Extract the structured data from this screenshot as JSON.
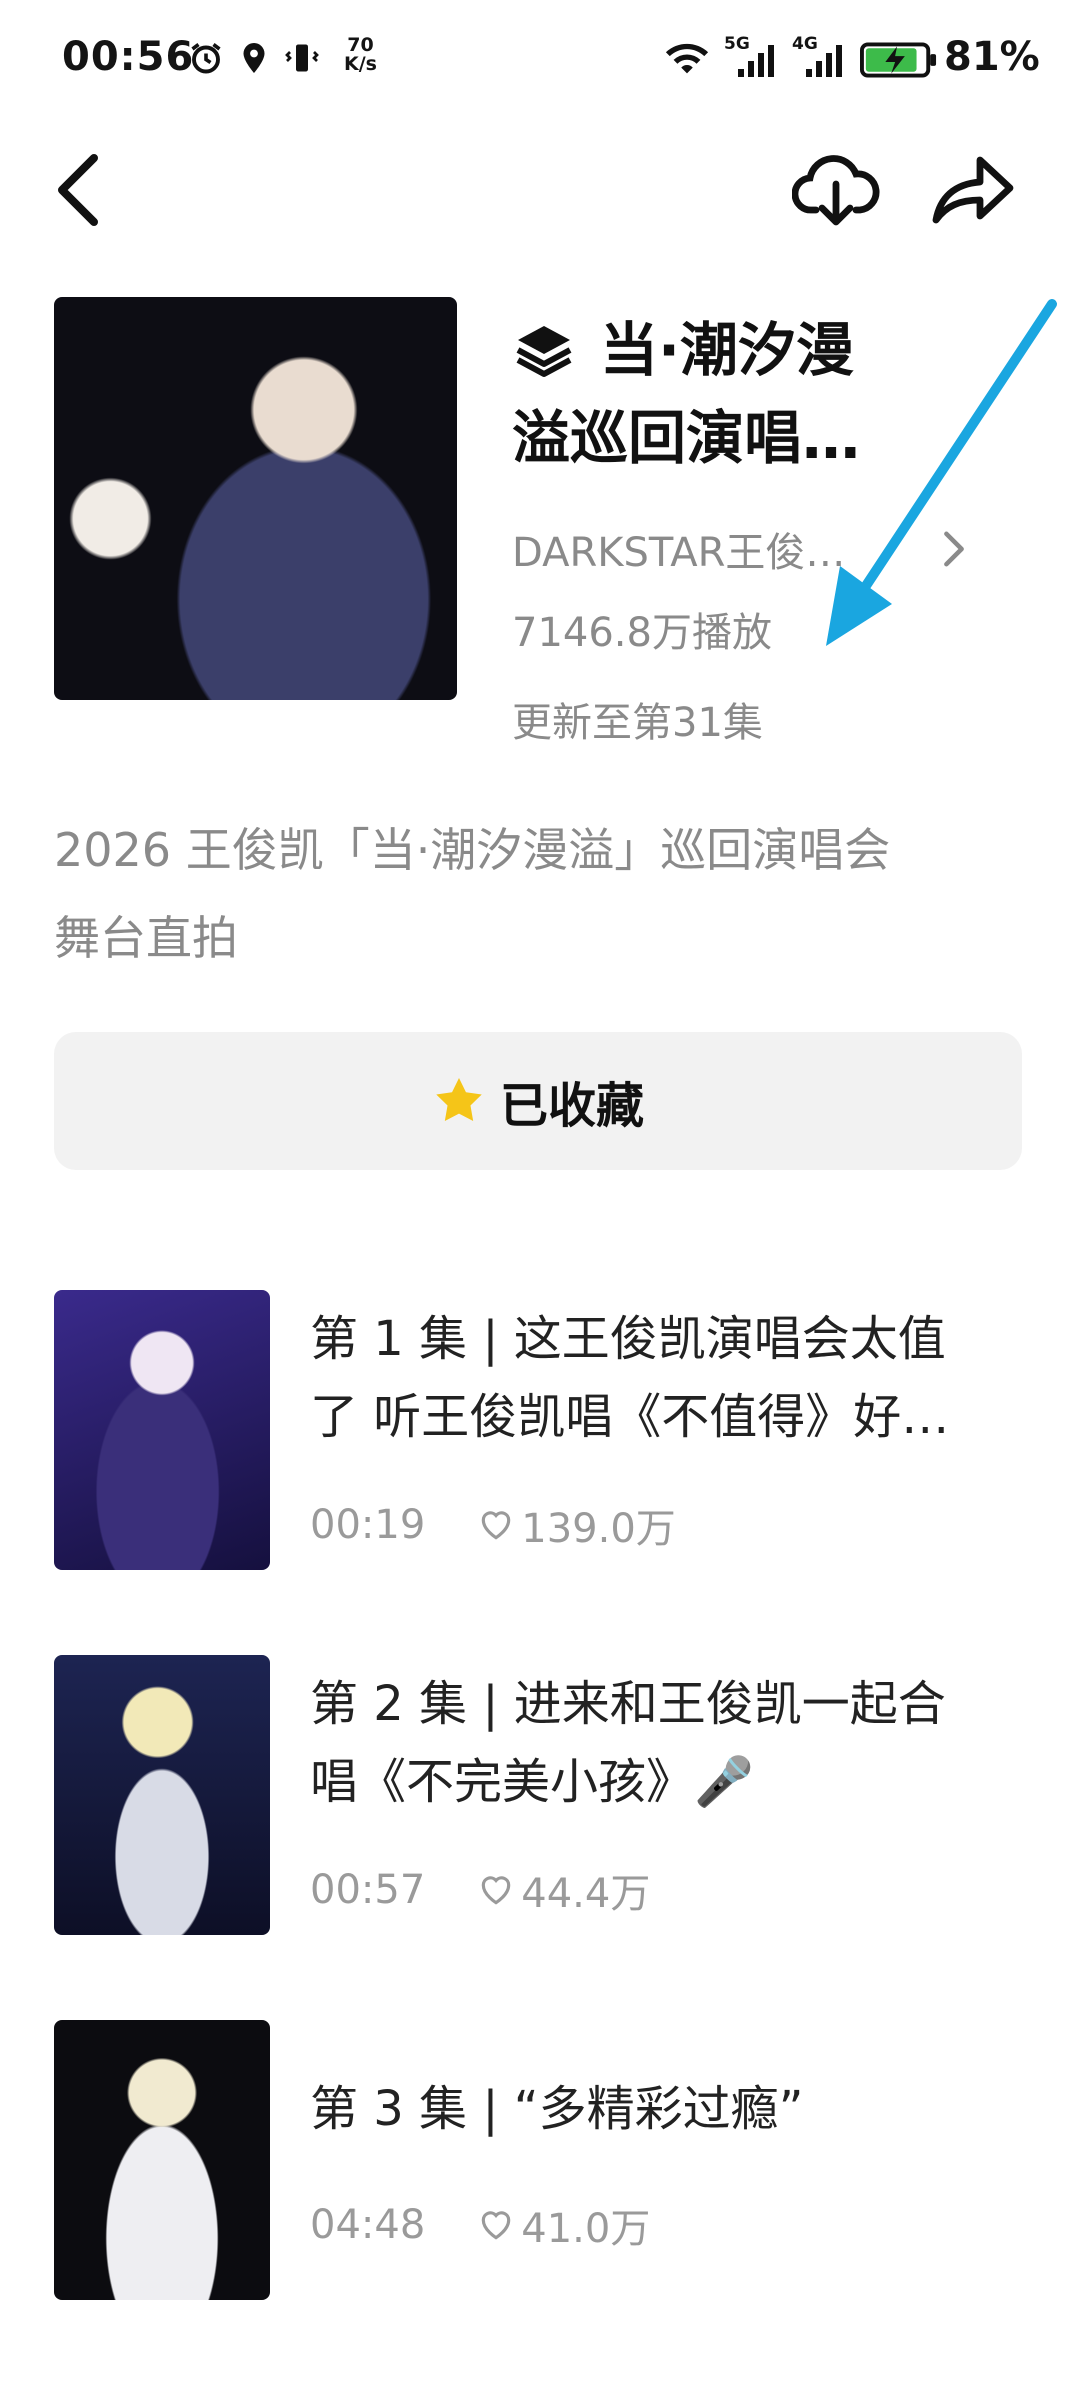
{
  "status_bar": {
    "time": "00:56",
    "net_speed_value": "70",
    "net_speed_unit": "K/s",
    "signal_1": "5G",
    "signal_2": "4G",
    "battery": "81%",
    "icons": [
      "alarm-icon",
      "location-icon",
      "vibrate-icon",
      "wifi-icon",
      "signal-icon",
      "battery-charging-icon"
    ]
  },
  "nav": {
    "icons": [
      "back-icon",
      "download-icon",
      "share-icon"
    ]
  },
  "series": {
    "title_line1": "当·潮汐漫",
    "title_line2": "溢巡回演唱…",
    "title_icon": "layers-icon",
    "author": "DARKSTAR王俊…",
    "plays": "7146.8万播放",
    "update": "更新至第31集",
    "description_line1": "2026 王俊凯「当·潮汐漫溢」巡回演唱会",
    "description_line2": "舞台直拍"
  },
  "collect_button": {
    "label": "已收藏",
    "icon": "star-icon",
    "star_color": "#f5c518"
  },
  "annotation": {
    "arrow_color": "#1aa6e0"
  },
  "episodes": [
    {
      "title_line1": "第 1 集 | 这王俊凯演唱会太值",
      "title_line2": "了 听王俊凯唱《不值得》好…",
      "duration": "00:19",
      "likes": "139.0万"
    },
    {
      "title_line1": "第 2 集 | 进来和王俊凯一起合",
      "title_line2": "唱《不完美小孩》🎤",
      "duration": "00:57",
      "likes": "44.4万"
    },
    {
      "title_line1": "第 3 集 | “多精彩过瘾”",
      "title_line2": "",
      "duration": "04:48",
      "likes": "41.0万"
    }
  ]
}
